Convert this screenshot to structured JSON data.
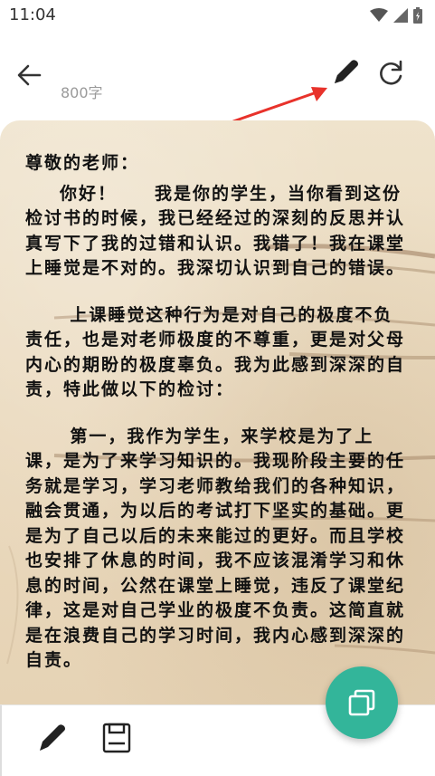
{
  "status_bar": {
    "time": "11:04"
  },
  "header": {
    "word_count": "800字"
  },
  "letter": {
    "greeting": "尊敬的老师：",
    "paragraphs": [
      "你好！　　我是你的学生，当你看到这份检讨书的时候，我已经经过的深刻的反思并认真写下了我的过错和认识。我错了！我在课堂上睡觉是不对的。我深切认识到自己的错误。",
      "上课睡觉这种行为是对自己的极度不负责任，也是对老师极度的不尊重，更是对父母内心的期盼的极度辜负。我为此感到深深的自责，特此做以下的检讨：",
      "第一，我作为学生，来学校是为了上课，是为了来学习知识的。我现阶段主要的任务就是学习，学习老师教给我们的各种知识，融会贯通，为以后的考试打下坚实的基础。更是为了自己以后的未来能过的更好。而且学校也安排了休息的时间，我不应该混淆学习和休息的时间，公然在课堂上睡觉，违反了课堂纪律，这是对自己学业的极度不负责。这简直就是在浪费自己的学习时间，我内心感到深深的自责。"
    ]
  },
  "icons": {
    "back": "back-arrow-icon",
    "pen": "pen-icon",
    "refresh": "refresh-icon",
    "edit": "edit-pen-icon",
    "save": "save-icon",
    "copy": "copy-icon"
  },
  "colors": {
    "accent": "#33b59a",
    "annotation": "#e8322b"
  }
}
